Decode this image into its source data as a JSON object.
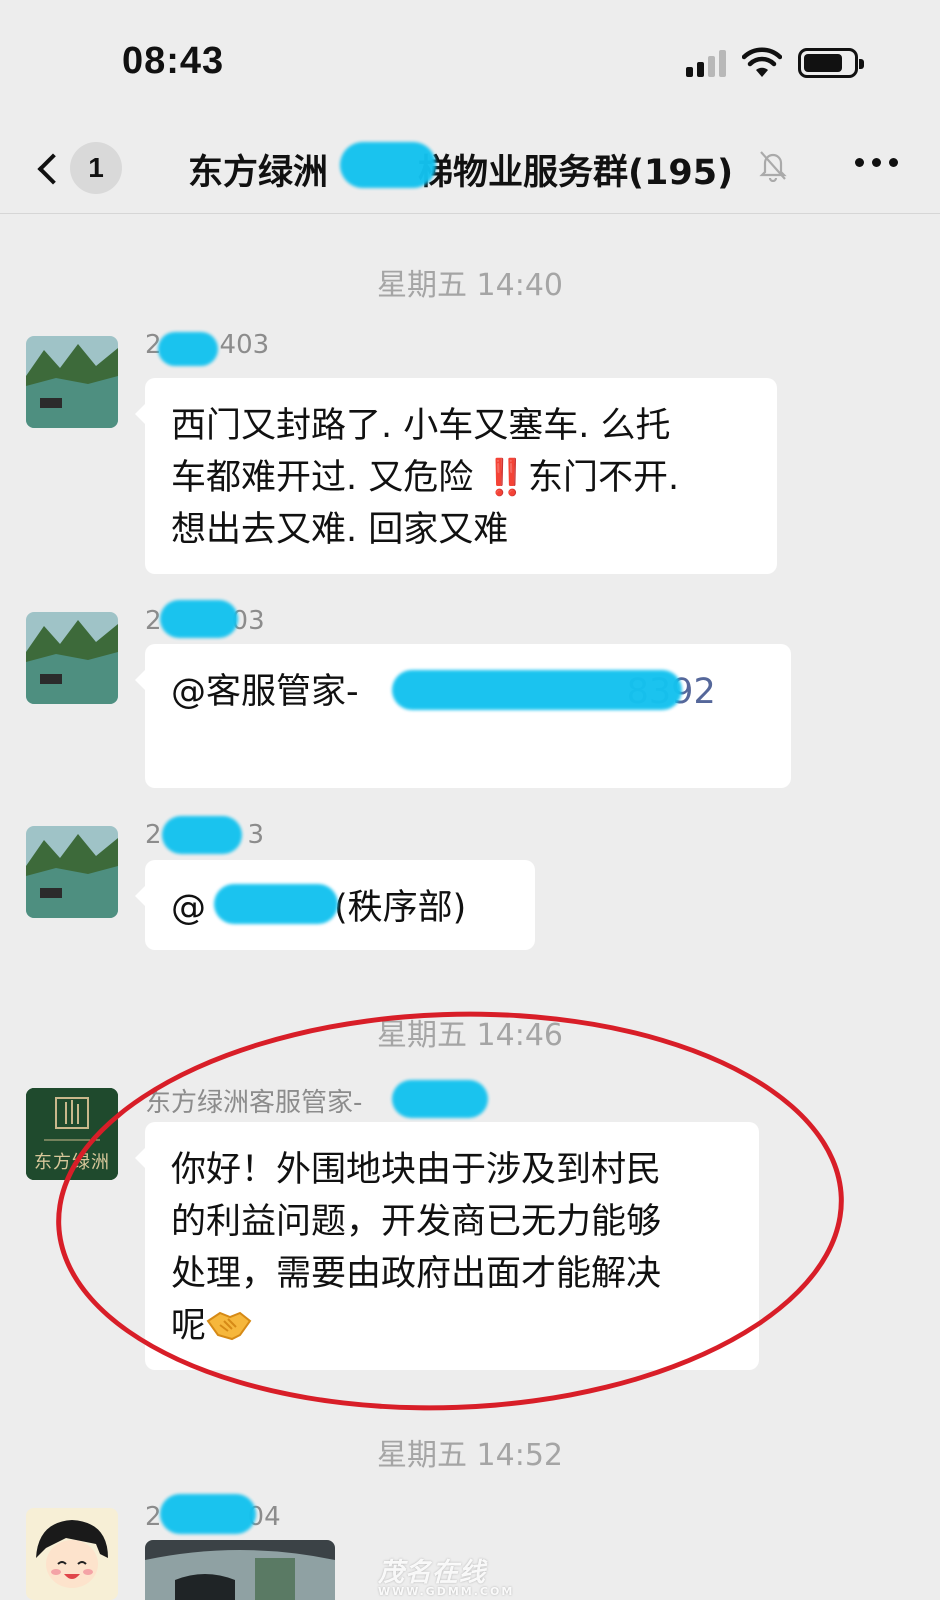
{
  "status_bar": {
    "time": "08:43",
    "icons": [
      "signal-icon",
      "wifi-icon",
      "battery-icon"
    ]
  },
  "nav": {
    "back_icon": "chevron-left-icon",
    "unread_count": "1",
    "title_prefix": "东方绿洲",
    "title_suffix": "梯物业服务群(195)",
    "mute_icon": "bell-muted-icon",
    "more_icon": "more-dots-icon"
  },
  "messages": {
    "ts1": "星期五 14:40",
    "m1": {
      "sender_start": "2",
      "sender_end": "403",
      "lines": [
        "西门又封路了. 小车又塞车. 么托",
        "车都难开过. 又危险",
        "想出去又难. 回家又难"
      ],
      "emoji": "‼️",
      "after_emoji": "东门不开."
    },
    "m2": {
      "sender_start": "2",
      "sender_end": "03",
      "mention_start": "@客服管家-",
      "mention_end": "8392"
    },
    "m3": {
      "sender_start": "2",
      "sender_end": "3",
      "mention_start": "@",
      "mention_end": "(秩序部)"
    },
    "ts2": "星期五 14:46",
    "m4": {
      "sender": "东方绿洲客服管家-",
      "avatar_text": "东方绿洲",
      "lines": [
        "你好！外围地块由于涉及到村民",
        "的利益问题，开发商已无力能够",
        "处理，需要由政府出面才能解决",
        "呢"
      ],
      "emoji": "🤝"
    },
    "ts3": "星期五 14:52",
    "m5": {
      "sender_start": "2",
      "sender_end": "04"
    }
  },
  "watermark": {
    "brand": "茂名在线",
    "url": "WWW.GDMM.COM"
  },
  "colors": {
    "background": "#ededed",
    "bubble": "#ffffff",
    "redaction": "#14c2ef",
    "annotation_circle": "#d81e28",
    "mention_link": "#55679a"
  }
}
